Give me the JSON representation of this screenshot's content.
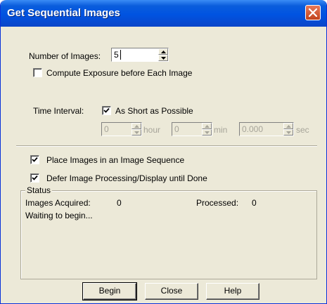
{
  "window": {
    "title": "Get Sequential Images"
  },
  "number_of_images": {
    "label": "Number of Images:",
    "value": "5"
  },
  "compute_exposure": {
    "label": "Compute Exposure before Each Image",
    "checked": false
  },
  "time_interval": {
    "label": "Time Interval:",
    "as_short_as_possible": {
      "label": "As Short as Possible",
      "checked": true
    },
    "hour": {
      "value": "0",
      "unit": "hour"
    },
    "min": {
      "value": "0",
      "unit": "min"
    },
    "sec": {
      "value": "0.000",
      "unit": "sec"
    }
  },
  "place_in_sequence": {
    "label": "Place Images in an Image Sequence",
    "checked": true
  },
  "defer_processing": {
    "label": "Defer Image Processing/Display until Done",
    "checked": true
  },
  "status": {
    "legend": "Status",
    "images_acquired": {
      "label": "Images Acquired:",
      "value": "0"
    },
    "processed": {
      "label": "Processed:",
      "value": "0"
    },
    "message": "Waiting to begin..."
  },
  "buttons": {
    "begin": "Begin",
    "close": "Close",
    "help": "Help"
  },
  "colors": {
    "titlebar": "#0053e1",
    "face": "#ece9d8",
    "close_button": "#c0431c"
  },
  "icons": {
    "close": "close-icon",
    "checkmark": "checkmark-icon",
    "spin_up": "arrow-up-icon",
    "spin_down": "arrow-down-icon"
  }
}
